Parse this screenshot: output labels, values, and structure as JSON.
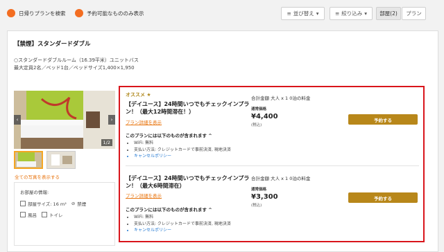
{
  "filters": {
    "day_trip_toggle": "日帰りプランを検索",
    "available_toggle": "予約可能なもののみ表示",
    "sort_label": "並び替え",
    "narrow_label": "絞り込み",
    "room_tab": "部屋(2)",
    "plan_tab": "プラン"
  },
  "room": {
    "title": "【禁煙】スタンダードダブル",
    "desc_line1": "○スタンダードダブルルーム（16.39平米）ユニットバス",
    "desc_line2": "最大定員2名／ベッド1台／ベッドサイズ1,400×1,950",
    "gallery_counter": "1/2",
    "show_all_photos": "全ての写真を表示する",
    "info_heading": "お部屋の情報:",
    "size_label": "部屋サイズ: 16 m²",
    "nonsmoking": "禁煙",
    "bath": "風呂",
    "toilet": "トイレ"
  },
  "plans": [
    {
      "badge": "オススメ ★",
      "name": "【デイユース】24時間いつでもチェックインプラン！（最大12時間滞在！）",
      "detail_link": "プラン詳細を表示",
      "included_heading": "このプランには以下のものが含まれます ^",
      "bullets": [
        "WiFi: 無料",
        "支払い方法: クレジットカードで事前決済, 現地決済"
      ],
      "cancel_policy": "キャンセルポリシー",
      "total_label": "合計金額  大人 x 1 0泊の料金",
      "price_label": "通常価格",
      "price": "¥4,400",
      "tax": "(税込)",
      "reserve": "予約する"
    },
    {
      "badge": "",
      "name": "【デイユース】24時間いつでもチェックインプラン！（最大6時間滞在）",
      "detail_link": "プラン詳細を表示",
      "included_heading": "このプランには以下のものが含まれます ^",
      "bullets": [
        "WiFi: 無料",
        "支払い方法: クレジットカードで事前決済, 現地決済"
      ],
      "cancel_policy": "キャンセルポリシー",
      "total_label": "合計金額  大人 x 1 0泊の料金",
      "price_label": "通常価格",
      "price": "¥3,300",
      "tax": "(税込)",
      "reserve": "予約する"
    }
  ],
  "colors": {
    "accent_orange": "#f36d21",
    "gold": "#b8871a",
    "highlight_red": "#d9141b",
    "link_blue": "#1a73d0"
  }
}
